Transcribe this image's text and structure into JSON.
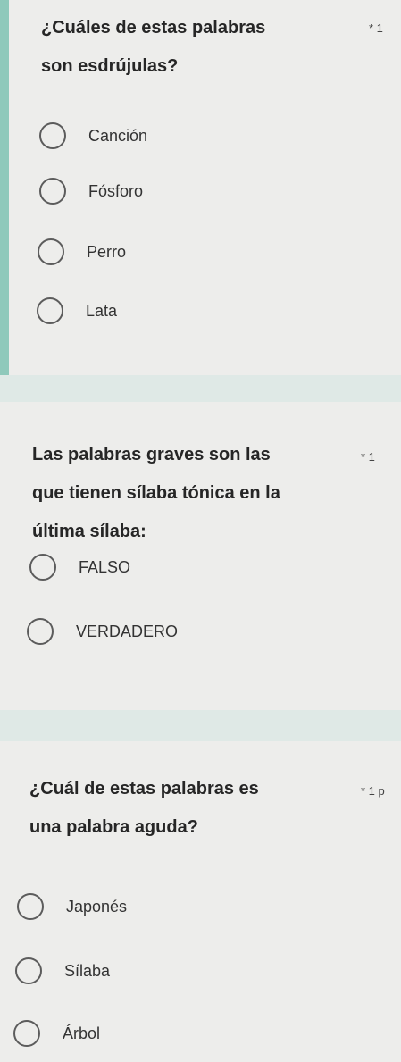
{
  "questions": [
    {
      "title_line1": "¿Cuáles de estas palabras",
      "title_line2": "son esdrújulas?",
      "required_mark": "* 1",
      "options": [
        "Canción",
        "Fósforo",
        "Perro",
        "Lata"
      ]
    },
    {
      "title_line1": "Las palabras graves son las",
      "title_line2": "que tienen sílaba tónica en la",
      "title_line3": "última sílaba:",
      "required_mark": "* 1",
      "options": [
        "FALSO",
        "VERDADERO"
      ]
    },
    {
      "title_line1": "¿Cuál de estas palabras es",
      "title_line2": "una palabra aguda?",
      "required_mark": "* 1 p",
      "options": [
        "Japonés",
        "Sílaba",
        "Árbol"
      ]
    }
  ]
}
